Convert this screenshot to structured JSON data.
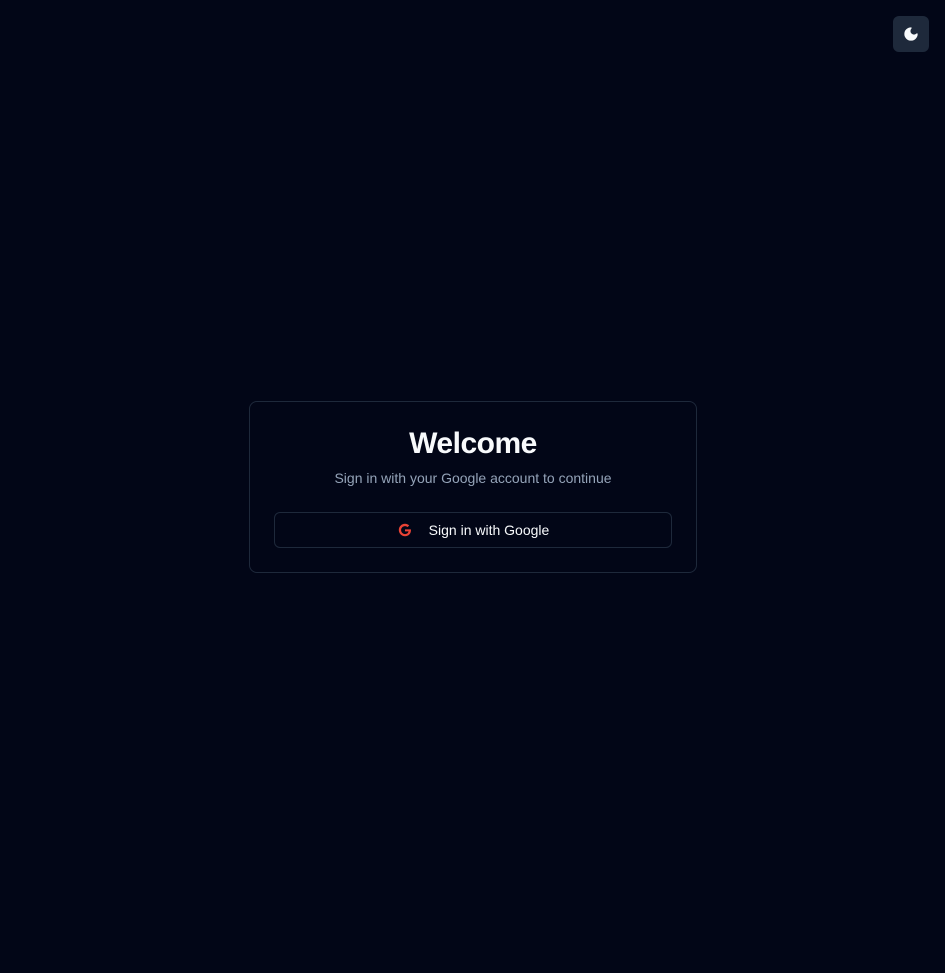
{
  "header": {
    "theme_toggle_icon": "moon-icon"
  },
  "login": {
    "title": "Welcome",
    "subtitle": "Sign in with your Google account to continue",
    "google_button_label": "Sign in with Google",
    "google_icon": "google-icon"
  },
  "colors": {
    "background": "#020617",
    "card_border": "#1e293b",
    "text_primary": "#f8fafc",
    "text_muted": "#94a3b8",
    "google_icon": "#ea4335"
  }
}
